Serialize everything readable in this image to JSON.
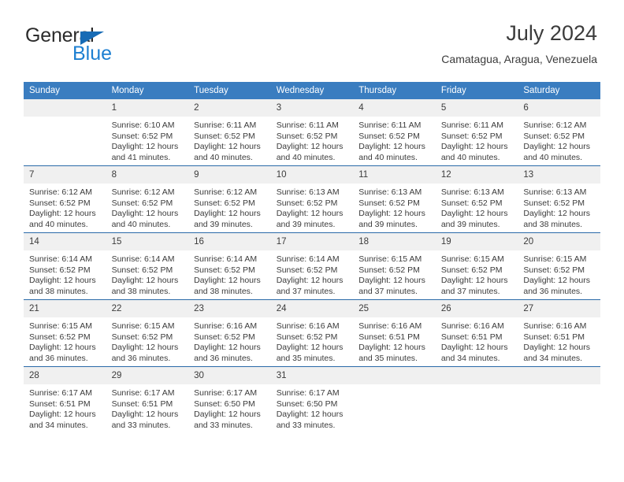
{
  "logo": {
    "word_one": "General",
    "word_two": "Blue",
    "triangle_icon": "triangle-icon",
    "color_dark": "#2b2b2b",
    "color_blue": "#1d7fd1"
  },
  "header": {
    "title": "July 2024",
    "subtitle": "Camatagua, Aragua, Venezuela"
  },
  "theme": {
    "header_bg": "#3a7dc0",
    "header_text": "#ffffff",
    "daynum_bg": "#f0f0f0",
    "separator": "#2a6aa8",
    "body_text": "#3b3b3b"
  },
  "weekday_headers": [
    "Sunday",
    "Monday",
    "Tuesday",
    "Wednesday",
    "Thursday",
    "Friday",
    "Saturday"
  ],
  "weeks": [
    [
      {
        "day": "",
        "sunrise": "",
        "sunset": "",
        "daylight_a": "",
        "daylight_b": ""
      },
      {
        "day": "1",
        "sunrise": "Sunrise: 6:10 AM",
        "sunset": "Sunset: 6:52 PM",
        "daylight_a": "Daylight: 12 hours",
        "daylight_b": "and 41 minutes."
      },
      {
        "day": "2",
        "sunrise": "Sunrise: 6:11 AM",
        "sunset": "Sunset: 6:52 PM",
        "daylight_a": "Daylight: 12 hours",
        "daylight_b": "and 40 minutes."
      },
      {
        "day": "3",
        "sunrise": "Sunrise: 6:11 AM",
        "sunset": "Sunset: 6:52 PM",
        "daylight_a": "Daylight: 12 hours",
        "daylight_b": "and 40 minutes."
      },
      {
        "day": "4",
        "sunrise": "Sunrise: 6:11 AM",
        "sunset": "Sunset: 6:52 PM",
        "daylight_a": "Daylight: 12 hours",
        "daylight_b": "and 40 minutes."
      },
      {
        "day": "5",
        "sunrise": "Sunrise: 6:11 AM",
        "sunset": "Sunset: 6:52 PM",
        "daylight_a": "Daylight: 12 hours",
        "daylight_b": "and 40 minutes."
      },
      {
        "day": "6",
        "sunrise": "Sunrise: 6:12 AM",
        "sunset": "Sunset: 6:52 PM",
        "daylight_a": "Daylight: 12 hours",
        "daylight_b": "and 40 minutes."
      }
    ],
    [
      {
        "day": "7",
        "sunrise": "Sunrise: 6:12 AM",
        "sunset": "Sunset: 6:52 PM",
        "daylight_a": "Daylight: 12 hours",
        "daylight_b": "and 40 minutes."
      },
      {
        "day": "8",
        "sunrise": "Sunrise: 6:12 AM",
        "sunset": "Sunset: 6:52 PM",
        "daylight_a": "Daylight: 12 hours",
        "daylight_b": "and 40 minutes."
      },
      {
        "day": "9",
        "sunrise": "Sunrise: 6:12 AM",
        "sunset": "Sunset: 6:52 PM",
        "daylight_a": "Daylight: 12 hours",
        "daylight_b": "and 39 minutes."
      },
      {
        "day": "10",
        "sunrise": "Sunrise: 6:13 AM",
        "sunset": "Sunset: 6:52 PM",
        "daylight_a": "Daylight: 12 hours",
        "daylight_b": "and 39 minutes."
      },
      {
        "day": "11",
        "sunrise": "Sunrise: 6:13 AM",
        "sunset": "Sunset: 6:52 PM",
        "daylight_a": "Daylight: 12 hours",
        "daylight_b": "and 39 minutes."
      },
      {
        "day": "12",
        "sunrise": "Sunrise: 6:13 AM",
        "sunset": "Sunset: 6:52 PM",
        "daylight_a": "Daylight: 12 hours",
        "daylight_b": "and 39 minutes."
      },
      {
        "day": "13",
        "sunrise": "Sunrise: 6:13 AM",
        "sunset": "Sunset: 6:52 PM",
        "daylight_a": "Daylight: 12 hours",
        "daylight_b": "and 38 minutes."
      }
    ],
    [
      {
        "day": "14",
        "sunrise": "Sunrise: 6:14 AM",
        "sunset": "Sunset: 6:52 PM",
        "daylight_a": "Daylight: 12 hours",
        "daylight_b": "and 38 minutes."
      },
      {
        "day": "15",
        "sunrise": "Sunrise: 6:14 AM",
        "sunset": "Sunset: 6:52 PM",
        "daylight_a": "Daylight: 12 hours",
        "daylight_b": "and 38 minutes."
      },
      {
        "day": "16",
        "sunrise": "Sunrise: 6:14 AM",
        "sunset": "Sunset: 6:52 PM",
        "daylight_a": "Daylight: 12 hours",
        "daylight_b": "and 38 minutes."
      },
      {
        "day": "17",
        "sunrise": "Sunrise: 6:14 AM",
        "sunset": "Sunset: 6:52 PM",
        "daylight_a": "Daylight: 12 hours",
        "daylight_b": "and 37 minutes."
      },
      {
        "day": "18",
        "sunrise": "Sunrise: 6:15 AM",
        "sunset": "Sunset: 6:52 PM",
        "daylight_a": "Daylight: 12 hours",
        "daylight_b": "and 37 minutes."
      },
      {
        "day": "19",
        "sunrise": "Sunrise: 6:15 AM",
        "sunset": "Sunset: 6:52 PM",
        "daylight_a": "Daylight: 12 hours",
        "daylight_b": "and 37 minutes."
      },
      {
        "day": "20",
        "sunrise": "Sunrise: 6:15 AM",
        "sunset": "Sunset: 6:52 PM",
        "daylight_a": "Daylight: 12 hours",
        "daylight_b": "and 36 minutes."
      }
    ],
    [
      {
        "day": "21",
        "sunrise": "Sunrise: 6:15 AM",
        "sunset": "Sunset: 6:52 PM",
        "daylight_a": "Daylight: 12 hours",
        "daylight_b": "and 36 minutes."
      },
      {
        "day": "22",
        "sunrise": "Sunrise: 6:15 AM",
        "sunset": "Sunset: 6:52 PM",
        "daylight_a": "Daylight: 12 hours",
        "daylight_b": "and 36 minutes."
      },
      {
        "day": "23",
        "sunrise": "Sunrise: 6:16 AM",
        "sunset": "Sunset: 6:52 PM",
        "daylight_a": "Daylight: 12 hours",
        "daylight_b": "and 36 minutes."
      },
      {
        "day": "24",
        "sunrise": "Sunrise: 6:16 AM",
        "sunset": "Sunset: 6:52 PM",
        "daylight_a": "Daylight: 12 hours",
        "daylight_b": "and 35 minutes."
      },
      {
        "day": "25",
        "sunrise": "Sunrise: 6:16 AM",
        "sunset": "Sunset: 6:51 PM",
        "daylight_a": "Daylight: 12 hours",
        "daylight_b": "and 35 minutes."
      },
      {
        "day": "26",
        "sunrise": "Sunrise: 6:16 AM",
        "sunset": "Sunset: 6:51 PM",
        "daylight_a": "Daylight: 12 hours",
        "daylight_b": "and 34 minutes."
      },
      {
        "day": "27",
        "sunrise": "Sunrise: 6:16 AM",
        "sunset": "Sunset: 6:51 PM",
        "daylight_a": "Daylight: 12 hours",
        "daylight_b": "and 34 minutes."
      }
    ],
    [
      {
        "day": "28",
        "sunrise": "Sunrise: 6:17 AM",
        "sunset": "Sunset: 6:51 PM",
        "daylight_a": "Daylight: 12 hours",
        "daylight_b": "and 34 minutes."
      },
      {
        "day": "29",
        "sunrise": "Sunrise: 6:17 AM",
        "sunset": "Sunset: 6:51 PM",
        "daylight_a": "Daylight: 12 hours",
        "daylight_b": "and 33 minutes."
      },
      {
        "day": "30",
        "sunrise": "Sunrise: 6:17 AM",
        "sunset": "Sunset: 6:50 PM",
        "daylight_a": "Daylight: 12 hours",
        "daylight_b": "and 33 minutes."
      },
      {
        "day": "31",
        "sunrise": "Sunrise: 6:17 AM",
        "sunset": "Sunset: 6:50 PM",
        "daylight_a": "Daylight: 12 hours",
        "daylight_b": "and 33 minutes."
      },
      {
        "day": "",
        "sunrise": "",
        "sunset": "",
        "daylight_a": "",
        "daylight_b": ""
      },
      {
        "day": "",
        "sunrise": "",
        "sunset": "",
        "daylight_a": "",
        "daylight_b": ""
      },
      {
        "day": "",
        "sunrise": "",
        "sunset": "",
        "daylight_a": "",
        "daylight_b": ""
      }
    ]
  ]
}
